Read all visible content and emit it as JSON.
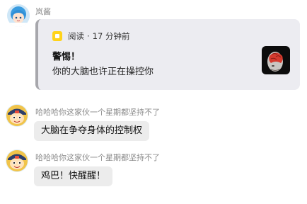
{
  "messages": [
    {
      "sender": "岚酱",
      "card": {
        "app_name": "阅读",
        "separator": "·",
        "time_ago": "17 分钟前",
        "title": "警惕！",
        "description": "你的大脑也许正在操控你",
        "app_color": "#ffd31a"
      }
    },
    {
      "sender": "哈哈哈你这家伙一个星期都坚持不了",
      "text": "大脑在争夺身体的控制权"
    },
    {
      "sender": "哈哈哈你这家伙一个星期都坚持不了",
      "text": "鸡巴！快醒醒！"
    }
  ],
  "icons": {
    "avatar_1": "blue-hair-girl-avatar",
    "avatar_2": "anime-character-avatar",
    "card_app": "reading-app-icon",
    "card_thumb": "brain-thumbnail"
  }
}
